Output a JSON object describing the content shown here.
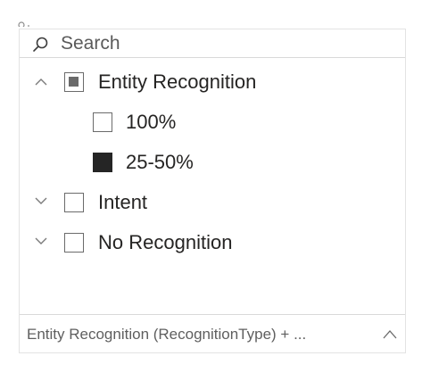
{
  "search": {
    "placeholder": "Search"
  },
  "tree": {
    "items": [
      {
        "label": "Entity Recognition",
        "state": "partial",
        "expanded": true,
        "children": [
          {
            "label": "100%",
            "state": "unchecked"
          },
          {
            "label": "25-50%",
            "state": "checked"
          }
        ]
      },
      {
        "label": "Intent",
        "state": "unchecked",
        "expanded": false
      },
      {
        "label": "No Recognition",
        "state": "unchecked",
        "expanded": false
      }
    ]
  },
  "footer": {
    "hierarchy_text": "Entity Recognition (RecognitionType) + ..."
  },
  "colors": {
    "text": "#252423",
    "checked_fill": "#252525",
    "partial_fill": "#6a6a6a",
    "border": "#d9d9d9"
  }
}
